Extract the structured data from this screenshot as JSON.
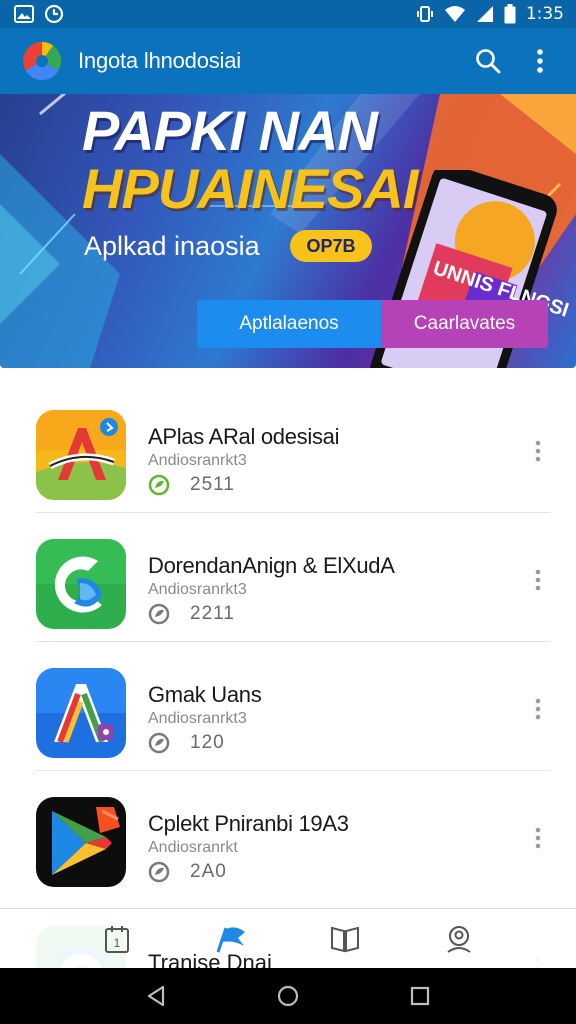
{
  "status_bar": {
    "time": "1:35"
  },
  "app_bar": {
    "title": "Ingota lhnodosiai"
  },
  "banner": {
    "title_line1": "PAPKI NAN",
    "title_line2": "HPUAINESAI",
    "subtitle": "Aplkad inaosia",
    "badge": "OP7B",
    "phone_screen_text": "UNNIS FLNGSI",
    "buttons": {
      "apps": "Aptlalaenos",
      "categories": "Caarlavates"
    }
  },
  "apps": [
    {
      "name": "APlas ARal odesisai",
      "developer": "Andiosranrkt3",
      "count": "2511"
    },
    {
      "name": "DorendanAnign & ElXudA",
      "developer": "Andiosranrkt3",
      "count": "2211"
    },
    {
      "name": "Gmak Uans",
      "developer": "Andiosranrkt3",
      "count": "120"
    },
    {
      "name": "Cplekt Pniranbi 19A3",
      "developer": "Andiosranrkt",
      "count": "2A0"
    }
  ],
  "peek_row": {
    "name": "Tranise Dnai"
  },
  "bottom_nav": {
    "calendar_badge": "1"
  },
  "colors": {
    "primary": "#0b72bd",
    "status_bar": "#0a64a8",
    "accent_blue": "#1d8cef",
    "accent_purple": "#b542b6",
    "yellow": "#f7c21a"
  }
}
